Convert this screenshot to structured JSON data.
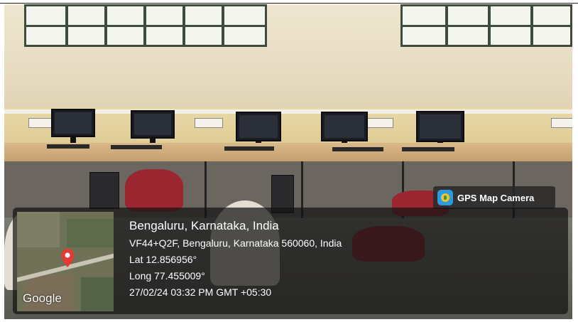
{
  "badge": {
    "label": "GPS Map Camera",
    "icon": "gps-map-camera-app-icon"
  },
  "location": {
    "place": "Bengaluru, Karnataka, India",
    "address": "VF44+Q2F, Bengaluru, Karnataka 560060, India",
    "latitude": "Lat 12.856956°",
    "longitude": "Long 77.455009°",
    "timestamp": "27/02/24 03:32 PM GMT +05:30"
  },
  "map_thumbnail": {
    "wordmark": "Google",
    "pin_color": "#e53935"
  },
  "colors": {
    "overlay": "#141414",
    "text": "#ffffff",
    "accent_pin": "#e53935"
  }
}
